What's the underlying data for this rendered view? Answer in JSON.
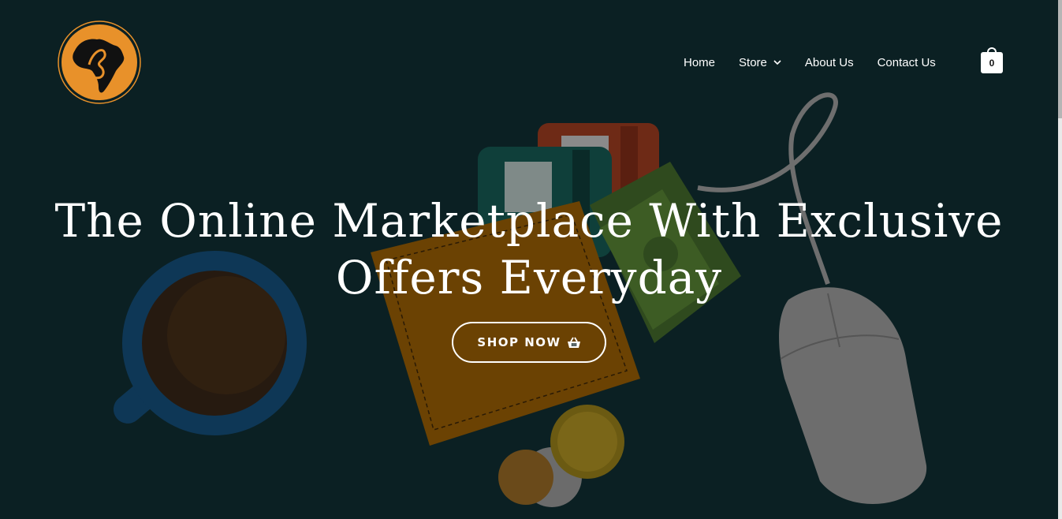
{
  "nav": {
    "items": [
      {
        "label": "Home"
      },
      {
        "label": "Store"
      },
      {
        "label": "About Us"
      },
      {
        "label": "Contact Us"
      }
    ]
  },
  "cart": {
    "count": "0",
    "icon": "shopping-bag-icon"
  },
  "hero": {
    "headline": "The Online Marketplace With Exclusive Offers Everyday",
    "cta_label": "SHOP NOW",
    "cta_icon": "basket-icon"
  },
  "colors": {
    "background": "#0b2023",
    "logo_orange": "#e8912a",
    "text": "#ffffff"
  }
}
